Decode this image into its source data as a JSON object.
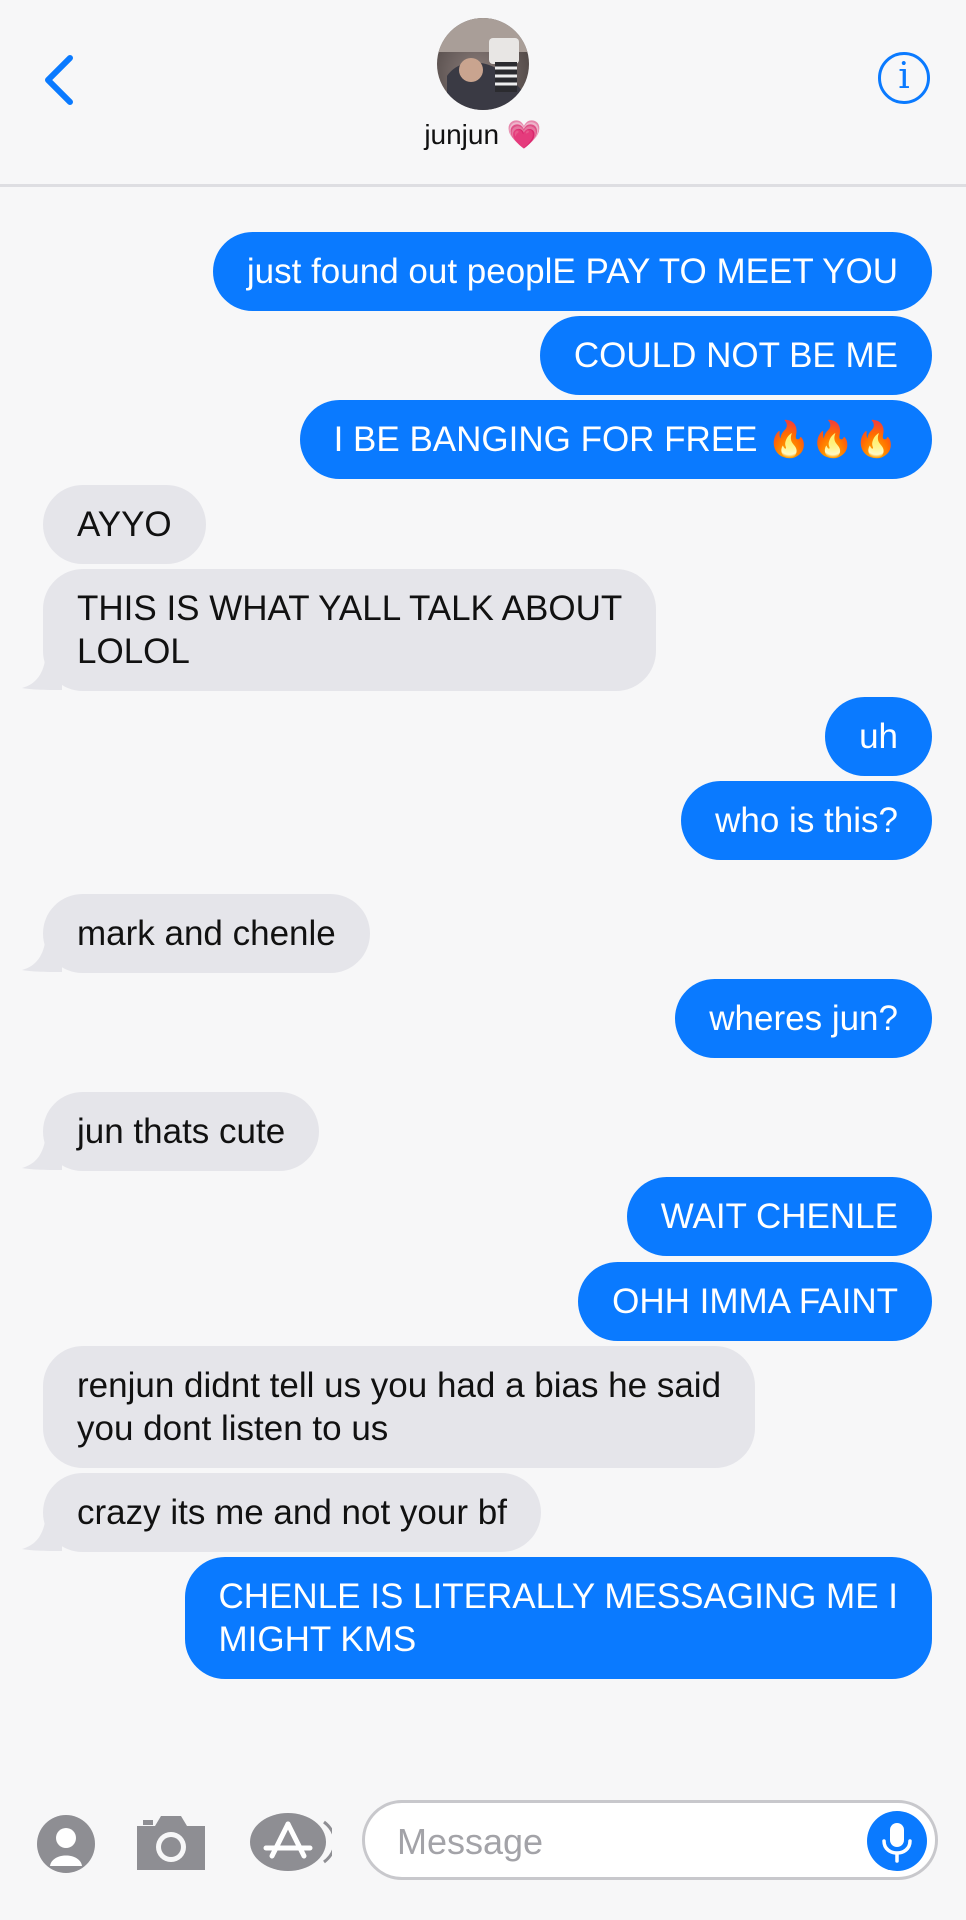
{
  "header": {
    "contact_name": "junjun 💗",
    "back_label": "Back",
    "info_label": "i"
  },
  "messages": [
    {
      "from": "me",
      "text": "just found out peoplE PAY TO MEET YOU"
    },
    {
      "from": "me",
      "text": "COULD NOT BE ME"
    },
    {
      "from": "me",
      "text": "I BE BANGING FOR FREE 🔥🔥🔥"
    },
    {
      "from": "them",
      "text": "AYYO"
    },
    {
      "from": "them",
      "text": "THIS IS WHAT YALL TALK ABOUT\nLOLOL"
    },
    {
      "from": "me",
      "text": "uh"
    },
    {
      "from": "me",
      "text": "who is this?"
    },
    {
      "from": "them",
      "text": "mark and chenle"
    },
    {
      "from": "me",
      "text": "wheres jun?"
    },
    {
      "from": "them",
      "text": "jun thats cute"
    },
    {
      "from": "me",
      "text": "WAIT CHENLE"
    },
    {
      "from": "me",
      "text": "OHH IMMA FAINT"
    },
    {
      "from": "them",
      "text": "renjun didnt tell us you had a bias he said\nyou dont listen to us"
    },
    {
      "from": "them",
      "text": "crazy its me and not your bf"
    },
    {
      "from": "me",
      "text": "CHENLE IS LITERALLY MESSAGING ME I\nMIGHT KMS"
    }
  ],
  "input": {
    "placeholder": "Message"
  },
  "icons": {
    "back": "chevron-left-icon",
    "info": "info-icon",
    "memoji": "memoji-icon",
    "camera": "camera-icon",
    "app_store": "app-store-icon",
    "mic": "microphone-icon"
  },
  "colors": {
    "sent_bubble": "#0a7aff",
    "received_bubble": "#e5e5ea",
    "accent": "#0a7aff"
  }
}
